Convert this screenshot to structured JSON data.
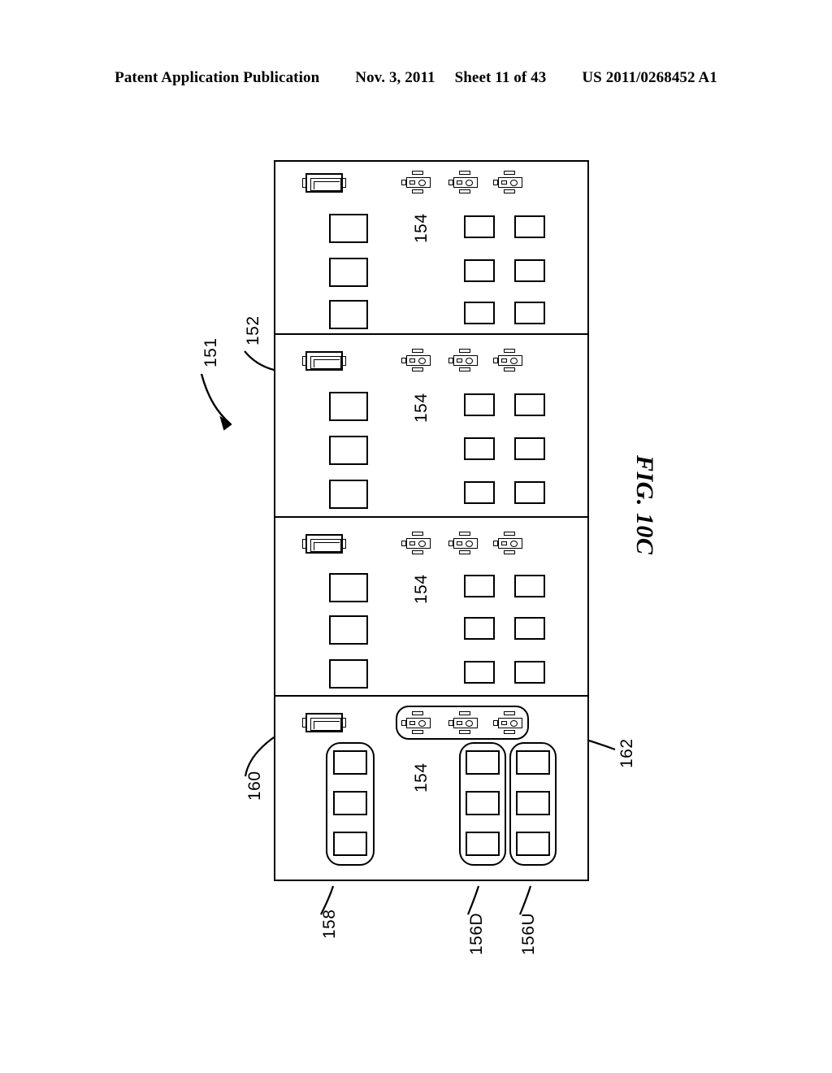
{
  "header": {
    "publication": "Patent Application Publication",
    "date": "Nov. 3, 2011",
    "sheet": "Sheet 11 of 43",
    "patent_number": "US 2011/0268452 A1"
  },
  "figure": {
    "label": "FIG. 10C"
  },
  "reference_numerals": {
    "assembly": "151",
    "panel_boundary": "152",
    "panel_interior": "154",
    "group_down": "156D",
    "group_up": "156U",
    "group_left": "158",
    "module": "160",
    "connector_group": "162"
  },
  "diagram": {
    "panels": [
      {
        "id": "panel-1",
        "interior_label": "154",
        "module": {
          "name": "module",
          "count": 1
        },
        "connectors": {
          "count": 3,
          "grouped": false
        },
        "left_column_boxes": 3,
        "right_columns": [
          3,
          3
        ],
        "grouped": false
      },
      {
        "id": "panel-2",
        "interior_label": "154",
        "module": {
          "name": "module",
          "count": 1
        },
        "connectors": {
          "count": 3,
          "grouped": false
        },
        "left_column_boxes": 3,
        "right_columns": [
          3,
          3
        ],
        "grouped": false
      },
      {
        "id": "panel-3",
        "interior_label": "154",
        "module": {
          "name": "module",
          "count": 1
        },
        "connectors": {
          "count": 3,
          "grouped": false
        },
        "left_column_boxes": 3,
        "right_columns": [
          3,
          3
        ],
        "grouped": false
      },
      {
        "id": "panel-4",
        "interior_label": "154",
        "module": {
          "name": "module",
          "count": 1
        },
        "connectors": {
          "count": 3,
          "grouped": true
        },
        "left_column_boxes": 3,
        "right_columns": [
          3,
          3
        ],
        "grouped": true
      }
    ]
  },
  "colors": {
    "line": "#000000",
    "background": "#ffffff"
  }
}
